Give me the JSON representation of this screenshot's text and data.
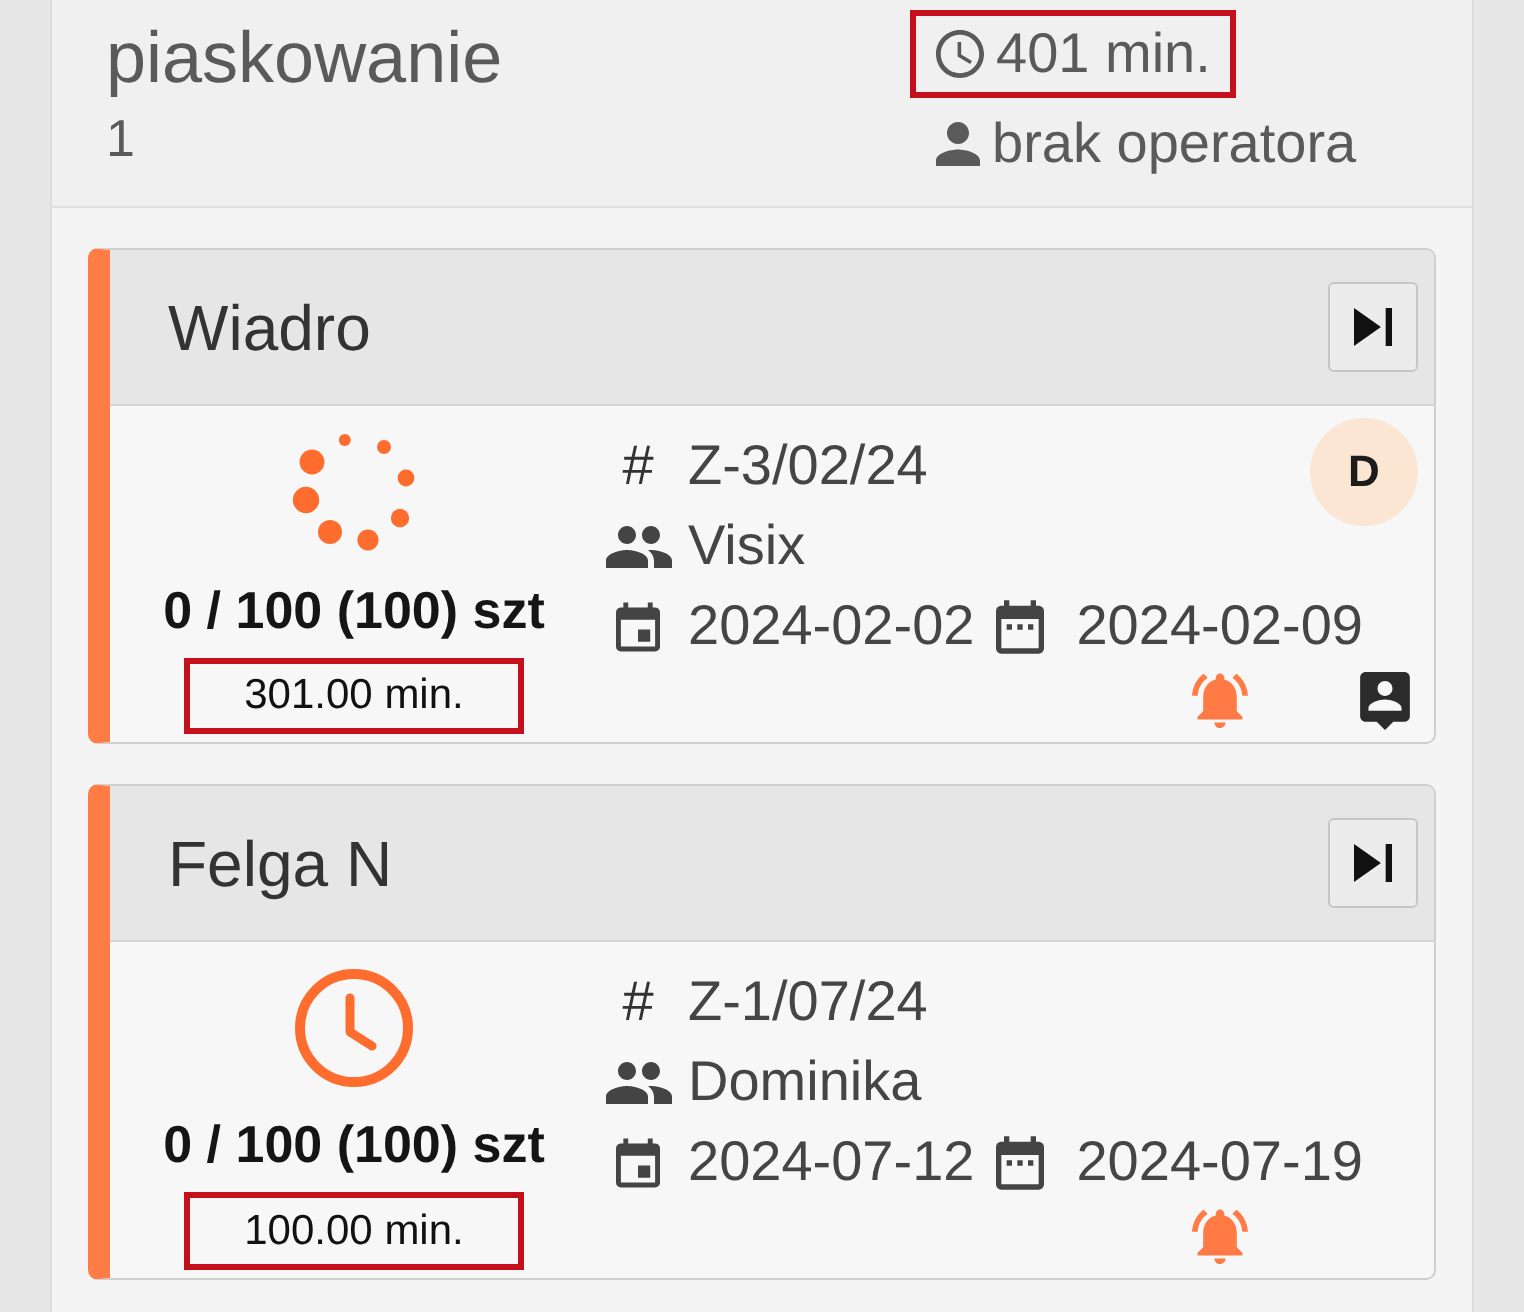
{
  "section": {
    "title": "piaskowanie",
    "count": "1",
    "time": {
      "text": "401 min.",
      "highlighted": true
    },
    "operator": "brak operatora"
  },
  "orders": [
    {
      "name": "Wiadro",
      "in_progress": true,
      "quantity": "0 / 100 (100) szt",
      "duration": {
        "text": "301.00 min.",
        "highlighted": true
      },
      "number_sign": "#",
      "number": "Z-3/02/24",
      "client": "Visix",
      "start_date": "2024-02-02",
      "end_date": "2024-02-09",
      "assignee": "D",
      "alarm": true,
      "contact": true
    },
    {
      "name": "Felga N",
      "in_progress": false,
      "quantity": "0 / 100 (100) szt",
      "duration": {
        "text": "100.00 min.",
        "highlighted": true
      },
      "number_sign": "#",
      "number": "Z-1/07/24",
      "client": "Dominika",
      "start_date": "2024-07-12",
      "end_date": "2024-07-19",
      "alarm": true,
      "contact": false
    }
  ]
}
